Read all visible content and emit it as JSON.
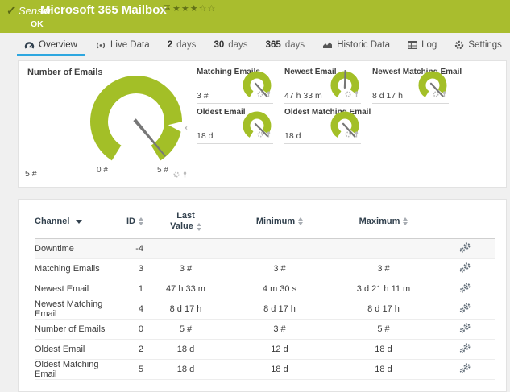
{
  "colors": {
    "brand_green": "#a9bd2e",
    "gauge_green": "#a3bf27",
    "accent_blue": "#2ea7e0",
    "header_navy": "#32414e"
  },
  "header": {
    "kind_label": "Sensor",
    "title": "Microsoft 365 Mailbox",
    "status": "OK",
    "stars": "★★★☆☆"
  },
  "tabs": {
    "overview": "Overview",
    "live_data": "Live Data",
    "days2_num": "2",
    "days2_word": "days",
    "days30_num": "30",
    "days30_word": "days",
    "days365_num": "365",
    "days365_word": "days",
    "historic": "Historic Data",
    "log": "Log",
    "settings": "Settings"
  },
  "gauges": {
    "main": {
      "title": "Number of Emails",
      "value": "5 #",
      "min_label": "0 #",
      "max_label": "5 #",
      "marker_label": "x"
    },
    "tiles": [
      {
        "title": "Matching Emails",
        "value": "3 #"
      },
      {
        "title": "Newest Email",
        "value": "47 h 33 m"
      },
      {
        "title": "Newest Matching Email",
        "value": "8 d 17 h"
      },
      {
        "title": "Oldest Email",
        "value": "18 d"
      },
      {
        "title": "Oldest Matching Email",
        "value": "18 d"
      }
    ]
  },
  "table": {
    "headers": {
      "channel": "Channel",
      "id": "ID",
      "last_value_line1": "Last",
      "last_value_line2": "Value",
      "minimum": "Minimum",
      "maximum": "Maximum"
    },
    "rows": [
      {
        "channel": "Downtime",
        "id": "-4",
        "last": "",
        "min": "",
        "max": ""
      },
      {
        "channel": "Matching Emails",
        "id": "3",
        "last": "3 #",
        "min": "3 #",
        "max": "3 #"
      },
      {
        "channel": "Newest Email",
        "id": "1",
        "last": "47 h 33 m",
        "min": "4 m 30 s",
        "max": "3 d 21 h 11 m"
      },
      {
        "channel": "Newest Matching Email",
        "id": "4",
        "last": "8 d 17 h",
        "min": "8 d 17 h",
        "max": "8 d 17 h"
      },
      {
        "channel": "Number of Emails",
        "id": "0",
        "last": "5 #",
        "min": "3 #",
        "max": "5 #"
      },
      {
        "channel": "Oldest Email",
        "id": "2",
        "last": "18 d",
        "min": "12 d",
        "max": "18 d"
      },
      {
        "channel": "Oldest Matching Email",
        "id": "5",
        "last": "18 d",
        "min": "18 d",
        "max": "18 d"
      }
    ]
  }
}
